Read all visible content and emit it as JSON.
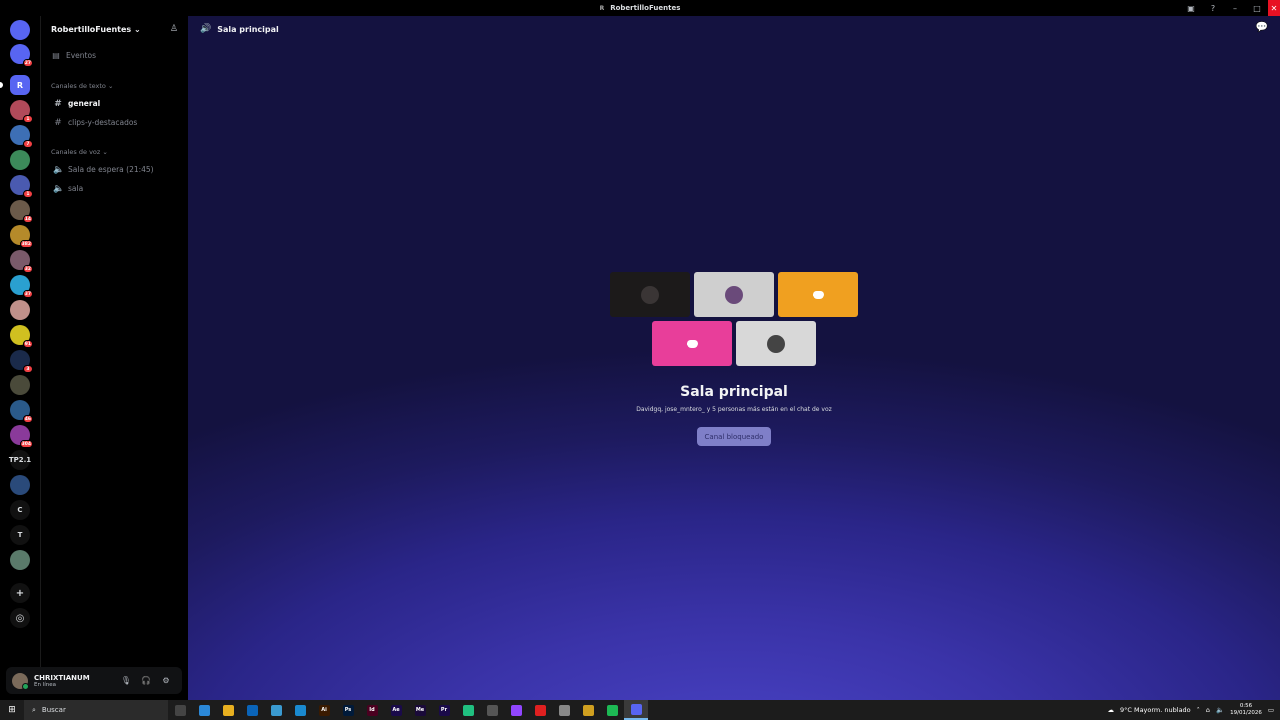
{
  "window": {
    "title": "RobertilloFuentes",
    "title_icon": "R"
  },
  "servers": [
    {
      "label": "",
      "color": "#5865f2",
      "badge": "",
      "icon": "discord-home-icon"
    },
    {
      "label": "",
      "color": "#5865f2",
      "badge": "27",
      "icon": "discord-dm-icon"
    },
    {
      "label": "R",
      "color": "#5865f2",
      "badge": "",
      "selected": true
    },
    {
      "label": "",
      "color": "#b14a5a",
      "badge": "1"
    },
    {
      "label": "",
      "color": "#3d6fb5",
      "badge": "7"
    },
    {
      "label": "",
      "color": "#3c8a5a",
      "badge": ""
    },
    {
      "label": "",
      "color": "#4a5ab0",
      "badge": "1"
    },
    {
      "label": "",
      "color": "#6b5a4a",
      "badge": "14"
    },
    {
      "label": "",
      "color": "#b58a2a",
      "badge": "382"
    },
    {
      "label": "",
      "color": "#7a5a6a",
      "badge": "32"
    },
    {
      "label": "",
      "color": "#2aa0d0",
      "badge": "37"
    },
    {
      "label": "",
      "color": "#c0908a",
      "badge": ""
    },
    {
      "label": "",
      "color": "#d0c020",
      "badge": "91"
    },
    {
      "label": "",
      "color": "#1a2a4a",
      "badge": "3"
    },
    {
      "label": "",
      "color": "#4a4a3a",
      "badge": ""
    },
    {
      "label": "",
      "color": "#2a5a8a",
      "badge": "46"
    },
    {
      "label": "",
      "color": "#8a3a9a",
      "badge": "304"
    },
    {
      "label": "TP2.1",
      "color": "#111111",
      "badge": ""
    },
    {
      "label": "",
      "color": "#2a4a7a",
      "badge": ""
    },
    {
      "label": "C",
      "color": "#111111",
      "badge": ""
    },
    {
      "label": "T",
      "color": "#111111",
      "badge": ""
    },
    {
      "label": "",
      "color": "#5a7a6a",
      "badge": ""
    }
  ],
  "sidebar": {
    "server_name": "RobertilloFuentes",
    "events_label": "Eventos",
    "text_category": "Canales de texto",
    "text_channels": [
      "general",
      "clips-y-destacados"
    ],
    "voice_category": "Canales de voz",
    "voice_channels": [
      "Sala de espera (21:45)",
      "sala"
    ]
  },
  "user": {
    "name": "CHRIXTIANUM",
    "status": "En línea"
  },
  "main": {
    "channel_title": "Sala principal",
    "tiles": [
      {
        "bg": "#1c1a1a",
        "kind": "avatar",
        "avatar_color": "#3a3535"
      },
      {
        "bg": "#cfcfcf",
        "kind": "avatar",
        "avatar_color": "#6a4a7a"
      },
      {
        "bg": "#f0a020",
        "kind": "discord"
      },
      {
        "bg": "#e83e9a",
        "kind": "discord"
      },
      {
        "bg": "#d8d8d8",
        "kind": "avatar",
        "avatar_color": "#444444"
      }
    ],
    "voice_title": "Sala principal",
    "voice_subtitle": "Davidgq, jose_mntero_ y 5 personas más están en el chat de voz",
    "locked_button": "Canal bloqueado"
  },
  "taskbar": {
    "search_placeholder": "Buscar",
    "apps": [
      {
        "name": "task-view",
        "color": "#444444",
        "label": ""
      },
      {
        "name": "store",
        "color": "#2b88d8",
        "label": ""
      },
      {
        "name": "explorer",
        "color": "#e8b020",
        "label": ""
      },
      {
        "name": "outlook",
        "color": "#0a64b8",
        "label": ""
      },
      {
        "name": "copilot",
        "color": "#3a9ad0",
        "label": ""
      },
      {
        "name": "edge",
        "color": "#1a8ad0",
        "label": ""
      },
      {
        "name": "illustrator",
        "color": "#3a1a00",
        "label": "Ai"
      },
      {
        "name": "photoshop",
        "color": "#001a3a",
        "label": "Ps"
      },
      {
        "name": "indesign",
        "color": "#4a0020",
        "label": "Id"
      },
      {
        "name": "after-effects",
        "color": "#1a0a4a",
        "label": "Ae"
      },
      {
        "name": "media-encoder",
        "color": "#1a0a3a",
        "label": "Me"
      },
      {
        "name": "premiere",
        "color": "#1a0a4a",
        "label": "Pr"
      },
      {
        "name": "app-green",
        "color": "#20c080",
        "label": ""
      },
      {
        "name": "app-circle",
        "color": "#555555",
        "label": ""
      },
      {
        "name": "twitch",
        "color": "#9146ff",
        "label": ""
      },
      {
        "name": "youtube",
        "color": "#e02020",
        "label": ""
      },
      {
        "name": "app-bird",
        "color": "#888888",
        "label": ""
      },
      {
        "name": "chrome",
        "color": "#d0a020",
        "label": ""
      },
      {
        "name": "spotify",
        "color": "#1db954",
        "label": ""
      },
      {
        "name": "discord",
        "color": "#5865f2",
        "label": "",
        "active": true
      }
    ],
    "weather": "9°C  Mayorm. nublado",
    "time": "0:56",
    "date": "19/01/2026"
  }
}
